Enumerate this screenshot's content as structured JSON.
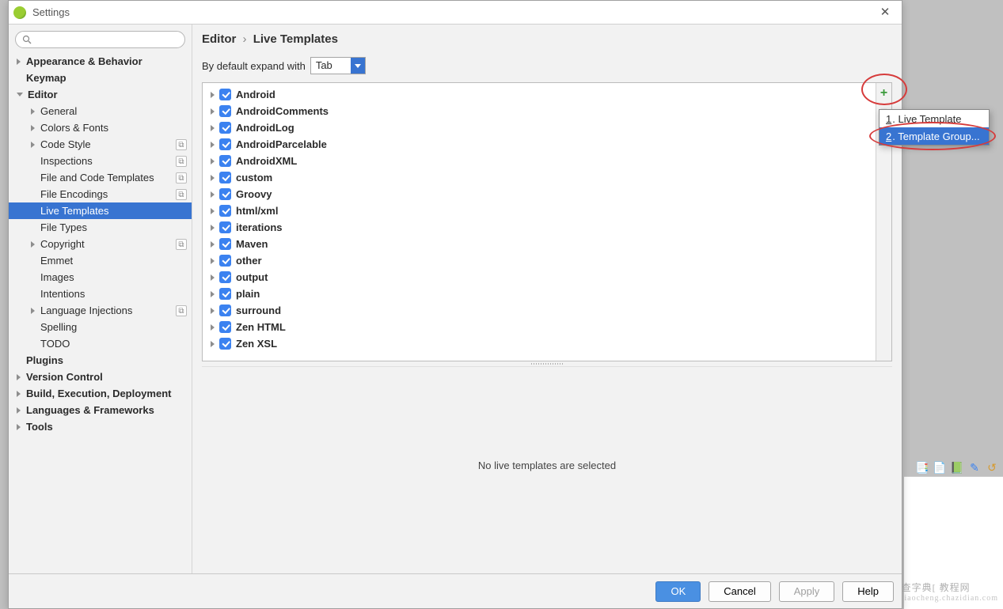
{
  "window": {
    "title": "Settings"
  },
  "breadcrumb": {
    "parent": "Editor",
    "current": "Live Templates"
  },
  "expand": {
    "label": "By default expand with",
    "value": "Tab"
  },
  "sidebar": {
    "items": [
      {
        "label": "Appearance & Behavior",
        "indent": 0,
        "bold": true,
        "arrow": "collapsed"
      },
      {
        "label": "Keymap",
        "indent": 0,
        "bold": true,
        "arrow": "none"
      },
      {
        "label": "Editor",
        "indent": 0,
        "bold": true,
        "arrow": "expanded"
      },
      {
        "label": "General",
        "indent": 1,
        "arrow": "collapsed"
      },
      {
        "label": "Colors & Fonts",
        "indent": 1,
        "arrow": "collapsed"
      },
      {
        "label": "Code Style",
        "indent": 1,
        "arrow": "collapsed",
        "badge": "⧉"
      },
      {
        "label": "Inspections",
        "indent": 1,
        "arrow": "none",
        "badge": "⧉"
      },
      {
        "label": "File and Code Templates",
        "indent": 1,
        "arrow": "none",
        "badge": "⧉"
      },
      {
        "label": "File Encodings",
        "indent": 1,
        "arrow": "none",
        "badge": "⧉"
      },
      {
        "label": "Live Templates",
        "indent": 1,
        "arrow": "none",
        "selected": true
      },
      {
        "label": "File Types",
        "indent": 1,
        "arrow": "none"
      },
      {
        "label": "Copyright",
        "indent": 1,
        "arrow": "collapsed",
        "badge": "⧉"
      },
      {
        "label": "Emmet",
        "indent": 1,
        "arrow": "none"
      },
      {
        "label": "Images",
        "indent": 1,
        "arrow": "none"
      },
      {
        "label": "Intentions",
        "indent": 1,
        "arrow": "none"
      },
      {
        "label": "Language Injections",
        "indent": 1,
        "arrow": "collapsed",
        "badge": "⧉"
      },
      {
        "label": "Spelling",
        "indent": 1,
        "arrow": "none"
      },
      {
        "label": "TODO",
        "indent": 1,
        "arrow": "none"
      },
      {
        "label": "Plugins",
        "indent": 0,
        "bold": true,
        "arrow": "none"
      },
      {
        "label": "Version Control",
        "indent": 0,
        "bold": true,
        "arrow": "collapsed"
      },
      {
        "label": "Build, Execution, Deployment",
        "indent": 0,
        "bold": true,
        "arrow": "collapsed"
      },
      {
        "label": "Languages & Frameworks",
        "indent": 0,
        "bold": true,
        "arrow": "collapsed"
      },
      {
        "label": "Tools",
        "indent": 0,
        "bold": true,
        "arrow": "collapsed"
      }
    ]
  },
  "templates": {
    "groups": [
      {
        "name": "Android",
        "checked": true
      },
      {
        "name": "AndroidComments",
        "checked": true
      },
      {
        "name": "AndroidLog",
        "checked": true
      },
      {
        "name": "AndroidParcelable",
        "checked": true
      },
      {
        "name": "AndroidXML",
        "checked": true
      },
      {
        "name": "custom",
        "checked": true
      },
      {
        "name": "Groovy",
        "checked": true
      },
      {
        "name": "html/xml",
        "checked": true
      },
      {
        "name": "iterations",
        "checked": true
      },
      {
        "name": "Maven",
        "checked": true
      },
      {
        "name": "other",
        "checked": true
      },
      {
        "name": "output",
        "checked": true
      },
      {
        "name": "plain",
        "checked": true
      },
      {
        "name": "surround",
        "checked": true
      },
      {
        "name": "Zen HTML",
        "checked": true
      },
      {
        "name": "Zen XSL",
        "checked": true
      }
    ]
  },
  "popup": {
    "item1_prefix": "1",
    "item1_label": ". Live Template",
    "item2_prefix": "2",
    "item2_label": ". Template Group..."
  },
  "detail": {
    "empty": "No live templates are selected"
  },
  "buttons": {
    "ok": "OK",
    "cancel": "Cancel",
    "apply": "Apply",
    "help": "Help"
  },
  "watermark": {
    "main": "查字典[ 教程网",
    "sub": "jiaocheng.chazidian.com"
  }
}
